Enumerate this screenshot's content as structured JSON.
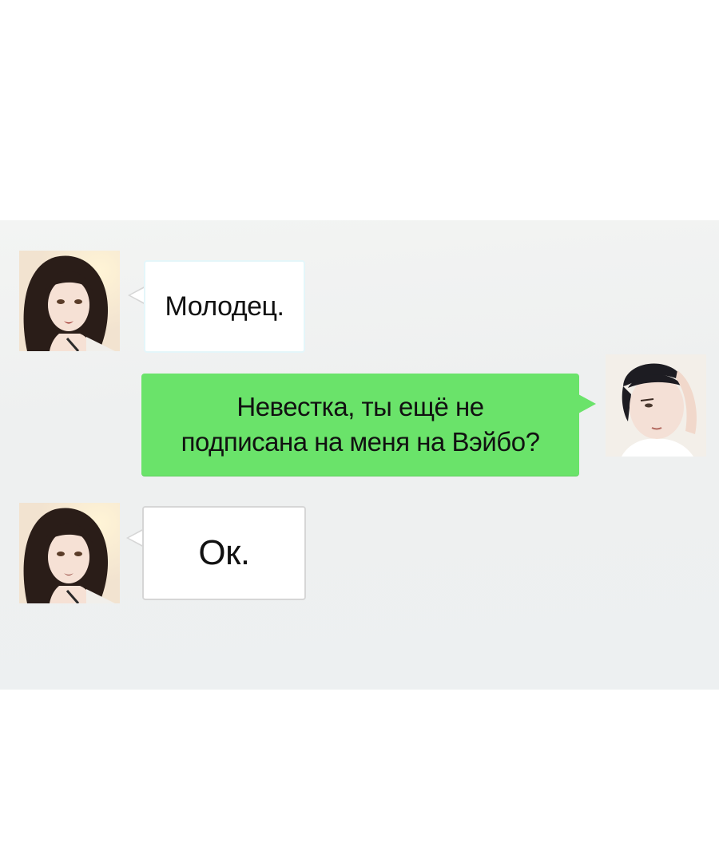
{
  "chat": {
    "messages": [
      {
        "sender": "heroine",
        "direction": "incoming",
        "text": "Молодец."
      },
      {
        "sender": "hero",
        "direction": "outgoing",
        "line1": "Невестка, ты ещё не",
        "line2": "подписана на меня на Вэйбо?"
      },
      {
        "sender": "heroine",
        "direction": "incoming",
        "text": "Ок."
      }
    ]
  },
  "colors": {
    "panel_background": "#eef0f0",
    "outgoing_bubble": "#6ae36a",
    "incoming_bubble": "#ffffff",
    "bubble_border": "#d6d6d6",
    "text": "#111111"
  },
  "icons": {
    "heroine_avatar": "woman-avatar-icon",
    "hero_avatar": "man-avatar-icon"
  }
}
